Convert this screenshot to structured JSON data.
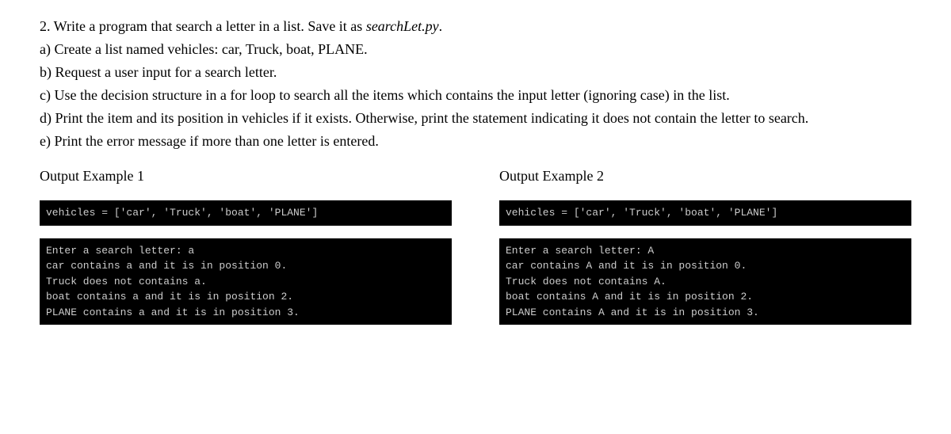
{
  "question": {
    "line1_prefix": "2. Write a program that search a letter in a list.  Save it as ",
    "line1_filename": "searchLet.py",
    "line1_suffix": ".",
    "line_a": "a) Create a list named vehicles: car, Truck, boat, PLANE.",
    "line_b": "b) Request a user input for a search letter.",
    "line_c": "c) Use the decision structure in a for loop to search all the items which contains the input letter (ignoring case) in the list.",
    "line_d": "d) Print the item and its position in vehicles if it exists.  Otherwise, print the statement indicating it does not contain the letter to search.",
    "line_e": "e) Print the error message if more than one letter is entered."
  },
  "example1": {
    "heading": "Output Example 1",
    "t1": "vehicles = ['car', 'Truck', 'boat', 'PLANE']",
    "t2": "Enter a search letter: a\ncar contains a and it is in position 0.\nTruck does not contains a.\nboat contains a and it is in position 2.\nPLANE contains a and it is in position 3."
  },
  "example2": {
    "heading": "Output Example 2",
    "t1": "vehicles = ['car', 'Truck', 'boat', 'PLANE']",
    "t2": "Enter a search letter: A\ncar contains A and it is in position 0.\nTruck does not contains A.\nboat contains A and it is in position 2.\nPLANE contains A and it is in position 3."
  }
}
